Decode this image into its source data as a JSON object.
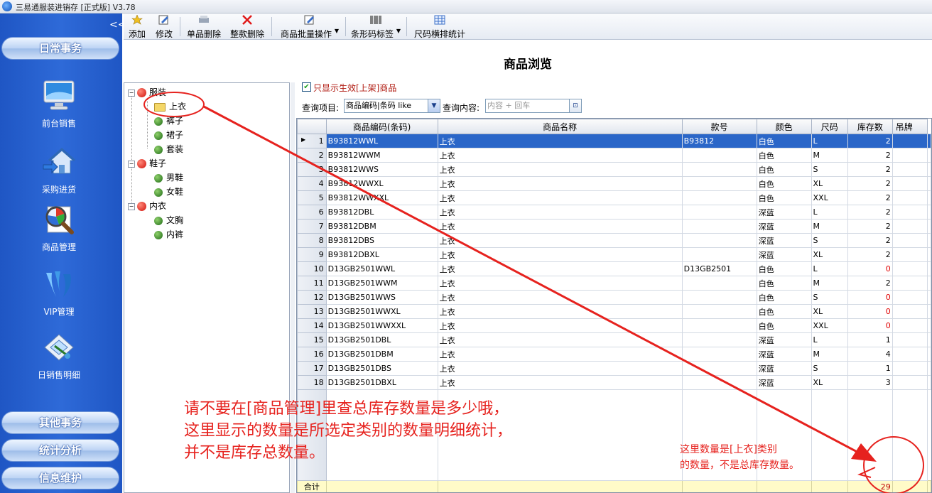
{
  "window": {
    "title": "三易通服装进销存 [正式版] V3.78"
  },
  "sidebar": {
    "collapse_glyph": "<<",
    "groups_top": [
      {
        "label": "日常事务"
      }
    ],
    "items": [
      {
        "label": "前台销售",
        "icon": "monitor-icon"
      },
      {
        "label": "采购进货",
        "icon": "house-arrow-icon"
      },
      {
        "label": "商品管理",
        "icon": "magnifier-chart-icon"
      },
      {
        "label": "VIP管理",
        "icon": "vip-icon"
      },
      {
        "label": "日销售明细",
        "icon": "report-icon"
      }
    ],
    "groups_bottom": [
      {
        "label": "其他事务"
      },
      {
        "label": "统计分析"
      },
      {
        "label": "信息维护"
      }
    ]
  },
  "toolbar": {
    "add": "添加",
    "edit": "修改",
    "delete_single": "单品删除",
    "delete_style": "整款删除",
    "batch": "商品批量操作",
    "barcode": "条形码标签",
    "size_stats": "尺码横排统计"
  },
  "page": {
    "title": "商品浏览"
  },
  "tree": {
    "nodes": [
      {
        "label": "服装",
        "level": 0,
        "icon": "apple-icon"
      },
      {
        "label": "上衣",
        "level": 1,
        "icon": "folder-icon",
        "selected": true
      },
      {
        "label": "裤子",
        "level": 1,
        "icon": "leaf-icon"
      },
      {
        "label": "裙子",
        "level": 1,
        "icon": "leaf-icon"
      },
      {
        "label": "套装",
        "level": 1,
        "icon": "leaf-icon"
      },
      {
        "label": "鞋子",
        "level": 0,
        "icon": "apple-icon"
      },
      {
        "label": "男鞋",
        "level": 1,
        "icon": "leaf-icon"
      },
      {
        "label": "女鞋",
        "level": 1,
        "icon": "leaf-icon"
      },
      {
        "label": "内衣",
        "level": 0,
        "icon": "apple-icon"
      },
      {
        "label": "文胸",
        "level": 1,
        "icon": "leaf-icon"
      },
      {
        "label": "内裤",
        "level": 1,
        "icon": "leaf-icon"
      }
    ]
  },
  "filter": {
    "active_only_label": "只显示生效[上架]商品",
    "active_only_checked": true,
    "query_field_label": "查询项目:",
    "query_field_value": "商品编码|条码 like",
    "query_content_label": "查询内容:",
    "query_content_placeholder": "内容 + 回车"
  },
  "grid": {
    "columns": [
      "商品编码(条码)",
      "商品名称",
      "款号",
      "颜色",
      "尺码",
      "库存数",
      "吊牌"
    ],
    "rows": [
      {
        "n": "1",
        "code": "B93812WWL",
        "name": "上衣",
        "style": "B93812",
        "color": "白色",
        "size": "L",
        "qty": "2"
      },
      {
        "n": "2",
        "code": "B93812WWM",
        "name": "上衣",
        "style": "",
        "color": "白色",
        "size": "M",
        "qty": "2"
      },
      {
        "n": "3",
        "code": "B93812WWS",
        "name": "上衣",
        "style": "",
        "color": "白色",
        "size": "S",
        "qty": "2"
      },
      {
        "n": "4",
        "code": "B93812WWXL",
        "name": "上衣",
        "style": "",
        "color": "白色",
        "size": "XL",
        "qty": "2"
      },
      {
        "n": "5",
        "code": "B93812WWXXL",
        "name": "上衣",
        "style": "",
        "color": "白色",
        "size": "XXL",
        "qty": "2"
      },
      {
        "n": "6",
        "code": "B93812DBL",
        "name": "上衣",
        "style": "",
        "color": "深蓝",
        "size": "L",
        "qty": "2"
      },
      {
        "n": "7",
        "code": "B93812DBM",
        "name": "上衣",
        "style": "",
        "color": "深蓝",
        "size": "M",
        "qty": "2"
      },
      {
        "n": "8",
        "code": "B93812DBS",
        "name": "上衣",
        "style": "",
        "color": "深蓝",
        "size": "S",
        "qty": "2"
      },
      {
        "n": "9",
        "code": "B93812DBXL",
        "name": "上衣",
        "style": "",
        "color": "深蓝",
        "size": "XL",
        "qty": "2"
      },
      {
        "n": "10",
        "code": "D13GB2501WWL",
        "name": "上衣",
        "style": "D13GB2501",
        "color": "白色",
        "size": "L",
        "qty": "0"
      },
      {
        "n": "11",
        "code": "D13GB2501WWM",
        "name": "上衣",
        "style": "",
        "color": "白色",
        "size": "M",
        "qty": "2"
      },
      {
        "n": "12",
        "code": "D13GB2501WWS",
        "name": "上衣",
        "style": "",
        "color": "白色",
        "size": "S",
        "qty": "0"
      },
      {
        "n": "13",
        "code": "D13GB2501WWXL",
        "name": "上衣",
        "style": "",
        "color": "白色",
        "size": "XL",
        "qty": "0"
      },
      {
        "n": "14",
        "code": "D13GB2501WWXXL",
        "name": "上衣",
        "style": "",
        "color": "白色",
        "size": "XXL",
        "qty": "0"
      },
      {
        "n": "15",
        "code": "D13GB2501DBL",
        "name": "上衣",
        "style": "",
        "color": "深蓝",
        "size": "L",
        "qty": "1"
      },
      {
        "n": "16",
        "code": "D13GB2501DBM",
        "name": "上衣",
        "style": "",
        "color": "深蓝",
        "size": "M",
        "qty": "4"
      },
      {
        "n": "17",
        "code": "D13GB2501DBS",
        "name": "上衣",
        "style": "",
        "color": "深蓝",
        "size": "S",
        "qty": "1"
      },
      {
        "n": "18",
        "code": "D13GB2501DBXL",
        "name": "上衣",
        "style": "",
        "color": "深蓝",
        "size": "XL",
        "qty": "3"
      }
    ],
    "total_label": "合计",
    "total_qty": "29"
  },
  "annotations": {
    "main": [
      "请不要在[商品管理]里查总库存数量是多少哦，",
      "这里显示的数量是所选定类别的数量明细统计，",
      "并不是库存总数量。"
    ],
    "side": [
      "这里数量是[上衣]类别",
      "的数量，不是总库存数量。"
    ],
    "color": "#e6221e"
  },
  "colors": {
    "sidebar": "#2a62d0",
    "selected_row": "#2a66c8",
    "total_row": "#fffbc8",
    "zero_qty": "#e00000"
  }
}
